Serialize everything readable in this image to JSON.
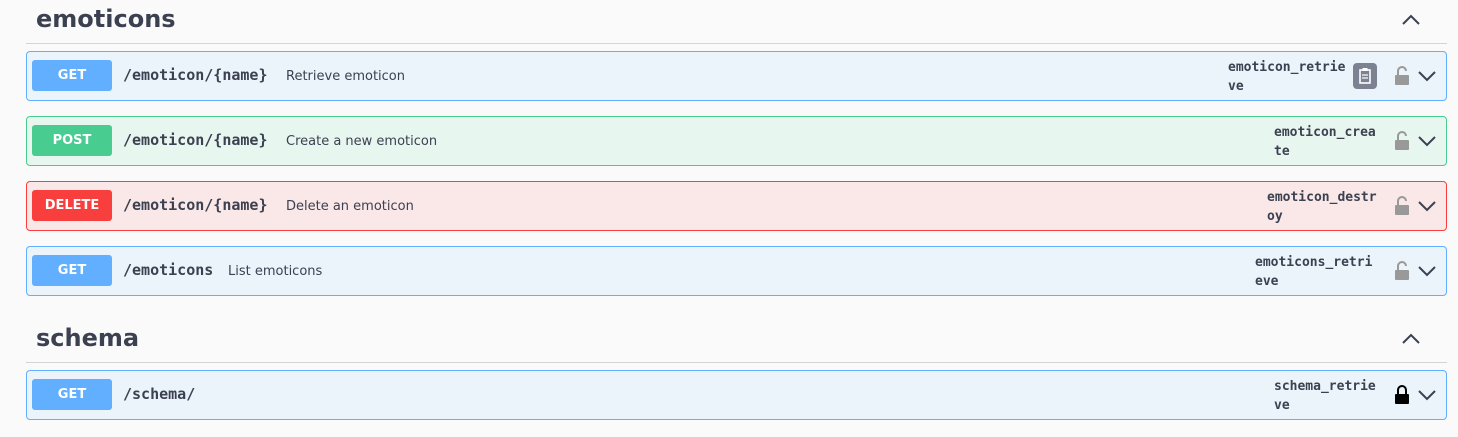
{
  "sections": [
    {
      "title": "emoticons",
      "operations": [
        {
          "method": "GET",
          "path": "/emoticon/{name}",
          "summary": "Retrieve emoticon",
          "operation_id": "emoticon_retrieve"
        },
        {
          "method": "POST",
          "path": "/emoticon/{name}",
          "summary": "Create a new emoticon",
          "operation_id": "emoticon_create"
        },
        {
          "method": "DELETE",
          "path": "/emoticon/{name}",
          "summary": "Delete an emoticon",
          "operation_id": "emoticon_destroy"
        },
        {
          "method": "GET",
          "path": "/emoticons",
          "summary": "List emoticons",
          "operation_id": "emoticons_retrieve"
        }
      ]
    },
    {
      "title": "schema",
      "operations": [
        {
          "method": "GET",
          "path": "/schema/",
          "summary": "",
          "operation_id": "schema_retrieve"
        }
      ]
    }
  ],
  "icons": {
    "collapse": "chevron-up-icon",
    "expand": "chevron-down-icon",
    "lock_open": "lock-open-icon",
    "lock_closed": "lock-closed-icon",
    "copy": "clipboard-copy-icon"
  },
  "colors": {
    "get": "#61affe",
    "post": "#49cc90",
    "delete": "#f93e3e",
    "get_bg": "#ebf3fb",
    "post_bg": "#e8f6f0",
    "delete_bg": "#fae7e7"
  }
}
